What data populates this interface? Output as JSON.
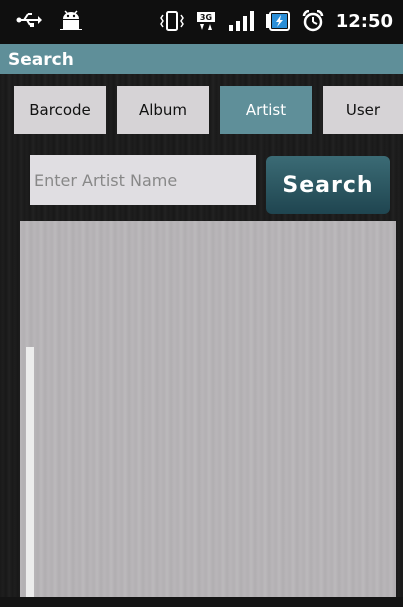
{
  "status_bar": {
    "time": "12:50",
    "icons": [
      "usb-icon",
      "android-debug-icon",
      "vibrate-icon",
      "network-3g-icon",
      "signal-icon",
      "battery-charging-icon",
      "alarm-icon"
    ]
  },
  "title_bar": {
    "title": "Search"
  },
  "tabs": [
    {
      "label": "Barcode",
      "active": false
    },
    {
      "label": "Album",
      "active": false
    },
    {
      "label": "Artist",
      "active": true
    },
    {
      "label": "User",
      "active": false
    }
  ],
  "search": {
    "placeholder": "Enter Artist Name",
    "value": "",
    "button_label": "Search"
  },
  "colors": {
    "accent": "#5f8f99",
    "button": "#2c5863",
    "tab": "#d6d3d6",
    "panel": "#b8b5b8"
  }
}
